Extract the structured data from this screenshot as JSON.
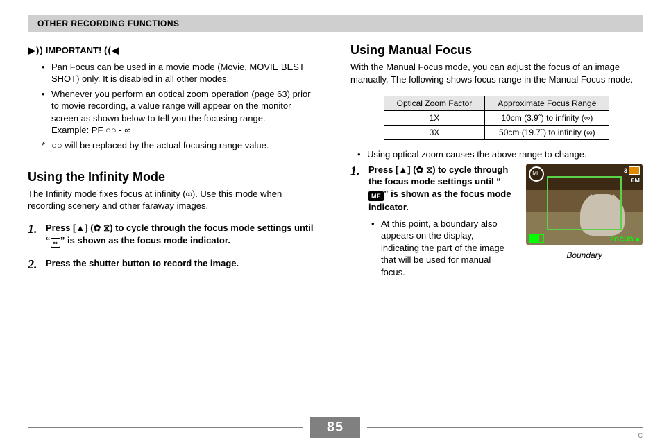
{
  "header": {
    "section_title": "OTHER RECORDING FUNCTIONS"
  },
  "important": {
    "label": "IMPORTANT!",
    "items": [
      "Pan Focus can be used in a movie mode (Movie, MOVIE BEST SHOT) only. It is disabled in all other modes.",
      "Whenever you perform an optical zoom operation (page 63) prior to movie recording, a value range will appear on the monitor screen as shown below to tell you the focusing range."
    ],
    "example_label": "Example: PF ○○    - ∞",
    "example_note": "○○ will be replaced by the actual focusing range value."
  },
  "infinity": {
    "heading": "Using the Infinity Mode",
    "desc": "The Infinity mode fixes focus at infinity (∞). Use this mode when recording scenery and other faraway images.",
    "steps": {
      "s1a": "Press [",
      "s1b": "] (",
      "s1c": ") to cycle through the focus mode settings until “",
      "s1d": "” is shown as the focus mode indicator.",
      "s2": "Press the shutter button to record the image."
    },
    "icons": {
      "up_triangle": "▲",
      "flower_glyph": "✿",
      "self_timer_glyph": "⧖",
      "infinity_glyph": "∞"
    }
  },
  "manual": {
    "heading": "Using Manual Focus",
    "desc": "With the Manual Focus mode, you can adjust the focus of an image manually. The following shows focus range in the Manual Focus mode.",
    "table": {
      "headers": [
        "Optical Zoom Factor",
        "Approximate Focus Range"
      ],
      "rows": [
        [
          "1X",
          "10cm (3.9˝) to infinity (∞)"
        ],
        [
          "3X",
          "50cm (19.7˝) to infinity (∞)"
        ]
      ]
    },
    "note": "Using optical zoom causes the above range to change.",
    "steps": {
      "s1a": "Press [",
      "s1b": "] (",
      "s1c": ") to cycle through the focus mode settings until “",
      "s1d": "” is shown as the focus mode indicator.",
      "s1_sub": "At this point, a boundary also appears on the display, indicating the part of the image that will be used for manual focus."
    },
    "icons": {
      "up_triangle": "▲",
      "flower_glyph": "✿",
      "self_timer_glyph": "⧖",
      "mf_label": "MF"
    },
    "figure": {
      "caption": "Boundary",
      "overlay": {
        "mf": "MF",
        "res": "6M",
        "three": "3",
        "focus": "FOCUS ■"
      }
    }
  },
  "footer": {
    "page_number": "85",
    "corner": "C"
  }
}
